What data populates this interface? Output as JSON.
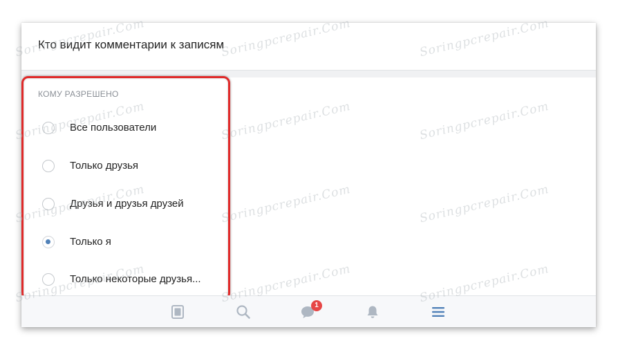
{
  "header": {
    "title": "Кто видит комментарии к записям"
  },
  "section": {
    "caption": "КОМУ РАЗРЕШЕНО"
  },
  "options": [
    {
      "label": "Все пользователи",
      "selected": false
    },
    {
      "label": "Только друзья",
      "selected": false
    },
    {
      "label": "Друзья и друзья друзей",
      "selected": false
    },
    {
      "label": "Только я",
      "selected": true
    },
    {
      "label": "Только некоторые друзья...",
      "selected": false
    }
  ],
  "tabbar": {
    "items": [
      {
        "icon": "news-icon"
      },
      {
        "icon": "search-icon"
      },
      {
        "icon": "messages-icon",
        "badge": "1"
      },
      {
        "icon": "bell-icon"
      },
      {
        "icon": "menu-icon",
        "active": true
      }
    ]
  },
  "colors": {
    "accent": "#5181b8",
    "badge": "#e64646",
    "highlight_frame": "#e02a2a",
    "icon_inactive": "#aeb7c2"
  },
  "watermark": {
    "text": "Soringpcrepair.Com"
  }
}
